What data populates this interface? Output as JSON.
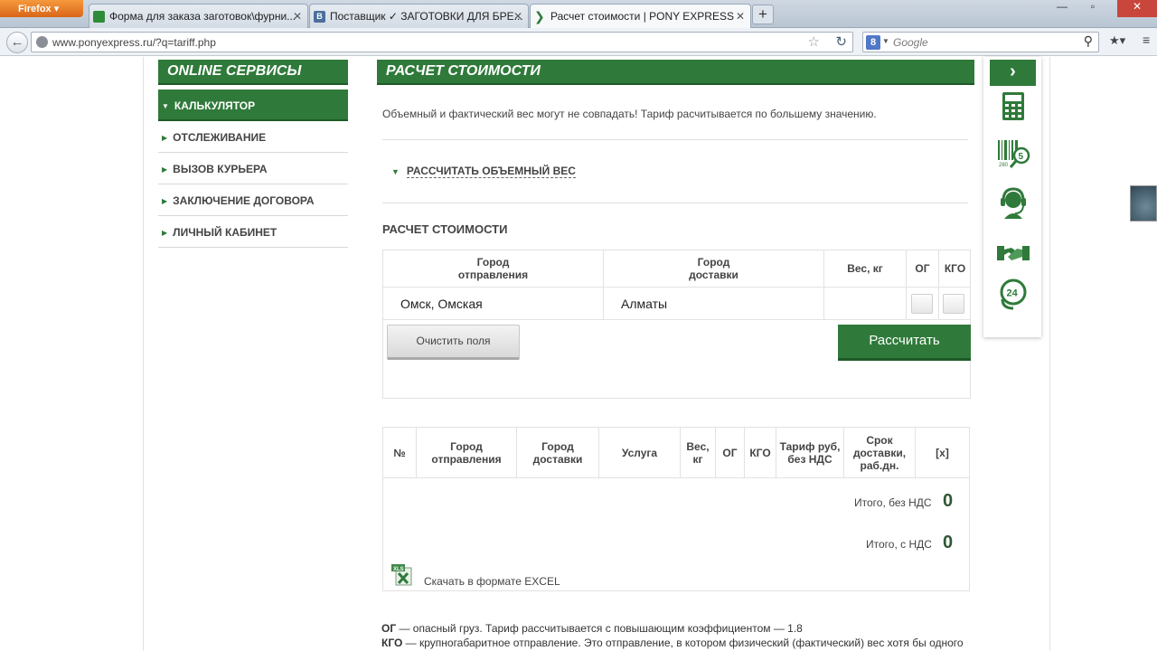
{
  "browser": {
    "app_button": "Firefox",
    "tabs": [
      {
        "title": "Форма для заказа заготовок\\фурни...",
        "icon_color": "#2e8b3a",
        "active": false
      },
      {
        "title": "Поставщик ✓ ЗАГОТОВКИ ДЛЯ БРЕ...",
        "icon_color": "#4a6f9c",
        "active": false
      },
      {
        "title": "Расчет стоимости | PONY EXPRESS",
        "icon_color": "#2f7a3a",
        "active": true
      }
    ],
    "url": "www.ponyexpress.ru/?q=tariff.php",
    "search_placeholder": "Google",
    "search_engine_letter": "8"
  },
  "sidebar": {
    "title": "ONLINE СЕРВИСЫ",
    "items": [
      {
        "label": "КАЛЬКУЛЯТОР",
        "active": true
      },
      {
        "label": "ОТСЛЕЖИВАНИЕ",
        "active": false
      },
      {
        "label": "ВЫЗОВ КУРЬЕРА",
        "active": false
      },
      {
        "label": "ЗАКЛЮЧЕНИЕ ДОГОВОРА",
        "active": false
      },
      {
        "label": "ЛИЧНЫЙ КАБИНЕТ",
        "active": false
      }
    ]
  },
  "main": {
    "title": "РАСЧЕТ СТОИМОСТИ",
    "notice": "Объемный и фактический вес могут не совпадать! Тариф расчитывается по большему значению.",
    "volume_link": "РАССЧИТАТЬ ОБЪЕМНЫЙ ВЕС",
    "section_title": "РАСЧЕТ СТОИМОСТИ",
    "form": {
      "col_from": "Город\nотправления",
      "col_to": "Город\nдоставки",
      "col_weight": "Вес, кг",
      "col_og": "ОГ",
      "col_kgo": "КГО",
      "from_value": "Омск, Омская",
      "to_value": "Алматы",
      "weight_value": "",
      "clear_button": "Очистить поля",
      "calc_button": "Рассчитать"
    },
    "results": {
      "headers": [
        "№",
        "Город\nотправления",
        "Город\nдоставки",
        "Услуга",
        "Вес,\nкг",
        "ОГ",
        "КГО",
        "Тариф руб,\nбез НДС",
        "Срок\nдоставки,\nраб.дн.",
        "[x]"
      ],
      "total_no_vat_label": "Итого, без НДС",
      "total_no_vat_value": "0",
      "total_vat_label": "Итого, с НДС",
      "total_vat_value": "0",
      "excel_link": "Скачать в формате EXCEL",
      "excel_icon_text": "XLS"
    },
    "legend": {
      "og_term": "ОГ",
      "og_text": " — опасный груз. Тариф рассчитывается с повышающим коэффициентом — 1.8",
      "kgo_term": "КГО",
      "kgo_text": " — крупногабаритное отправление. Это отправление, в котором физический (фактический) вес хотя бы одного"
    }
  },
  "rail": {
    "arrow": "›",
    "icons": [
      "calculator-icon",
      "barcode-tracking-icon",
      "operator-headset-icon",
      "handshake-contract-icon",
      "support-24-icon"
    ],
    "badge_24": "24",
    "badge_5": "5",
    "barcode_caption": "280"
  },
  "colors": {
    "brand_green": "#2f7a3a",
    "brand_green_dark": "#1e5a27"
  }
}
